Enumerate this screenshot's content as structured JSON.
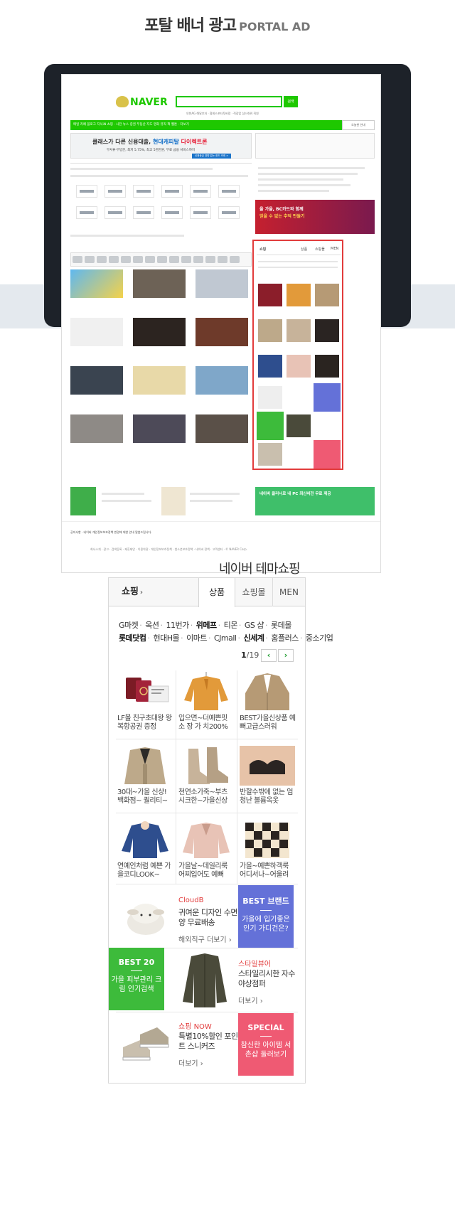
{
  "header": {
    "title": "포탈 배너 광고",
    "title_en": "PORTAL AD"
  },
  "naver": {
    "logo": "NAVER",
    "search_btn": "검색",
    "search_sub": "인천AG 해달부처 · 협회스포타투바람 · 직장탑 심터쉬워 직원",
    "menu": "메일 카페 블로그 지식iN 쇼핑 · 사전 뉴스 증권 부동산 지도 영화 뮤직 책 웹툰 · 더보기",
    "menu_right": "오늘한 안내",
    "banner_line1_a": "클래스가 다른 신용대출,",
    "banner_line1_b": "현대캐피탈",
    "banner_line1_c": "다이렉트론",
    "banner_line2": "무서류·무방문, 최저 5.75%, 최고 5천만원, 무료 금융 서비스까지",
    "banner_cta": "신용등급 영향 없는 한도 조회 >",
    "ad_line1": "올 가을, BC카드와 함께",
    "ad_line2": "믿을 수 없는 추억 만들기",
    "bottom_green": "네이버 클리너로 내 PC 최신버전 무료 제공",
    "footer1": "공지사항 · 네이버 개인정보보호정책 변경에 대한 안내 말씀드립니다.",
    "footer2": "회사소개 · 광고 · 검색등록 · 제휴제안 · 이용약관 · 개인정보보호정책 · 청소년보호정책 · 네이버 정책 · 고객센터 · © NAVER Corp."
  },
  "section_title": "네이버 테마쇼핑",
  "tabs": {
    "shop": "쇼핑",
    "items": [
      "상품",
      "쇼핑몰",
      "MEN"
    ]
  },
  "malls": {
    "row1": [
      "G마켓",
      "옥션",
      "11번가",
      "위메프",
      "티몬",
      "GS 샵",
      "롯데몰"
    ],
    "row2": [
      "롯데닷컴",
      "현대H몰",
      "이마트",
      "CJmall",
      "신세계",
      "홈플러스",
      "중소기업"
    ]
  },
  "pager": {
    "current": "1",
    "total": "/19"
  },
  "products": [
    {
      "caption": "LF몰 친구초대왕 왕복항공권 증정",
      "icon": "passport-icon",
      "color": "#8b1e2a"
    },
    {
      "caption": "입으면~더예쁜핏 소 장 가 치200%",
      "icon": "orange-sweater-icon",
      "color": "#e29a3a"
    },
    {
      "caption": "BEST가을신상품 예뻐고급스러워",
      "icon": "jacket-icon",
      "color": "#b69a75"
    },
    {
      "caption": "30대~가을 신상! 백화점~ 퀄리티~",
      "icon": "trench-coat-icon",
      "color": "#bda98a"
    },
    {
      "caption": "천연소가죽~부츠 시크한~가을신상",
      "icon": "ankle-boots-icon",
      "color": "#c7b39a"
    },
    {
      "caption": "반할수밖에 없는 엄청난 볼륨옥옷",
      "icon": "bra-top-icon",
      "color": "#2a2422"
    },
    {
      "caption": "연예인처럼 예쁜 가을코디LOOK~",
      "icon": "blue-knit-icon",
      "color": "#2e4e8e"
    },
    {
      "caption": "가을날~데일리룩 어찌입어도 예뻐",
      "icon": "pink-blouse-icon",
      "color": "#e8c3b6"
    },
    {
      "caption": "가을~예쁜하객룩 어디서나~어울려",
      "icon": "check-top-icon",
      "color": "#2a2420"
    }
  ],
  "promos": [
    {
      "tag": "CloudB",
      "text": "귀여운 디자인 수면양 무료배송",
      "more": "해외직구 더보기",
      "icon": "sheep-toy-icon",
      "block_title": "BEST 브랜드",
      "block_text": "가을에 입기좋은 인기 가디건은?",
      "block_color": "#6471d8"
    },
    {
      "tag": "스타일뷰어",
      "text": "스타일리시한 자수 야상점퍼",
      "more": "더보기",
      "icon": "field-jacket-icon",
      "block_title": "BEST 20",
      "block_text": "가을 피부관리 크림 인기검색",
      "block_color": "#3dbb3b"
    },
    {
      "tag": "쇼핑 NOW",
      "text": "특별10%할인 포인트 스니커즈",
      "more": "더보기",
      "icon": "sneakers-icon",
      "block_title": "SPECIAL",
      "block_text": "참신한 아이템 서촌샵 둘러보기",
      "block_color": "#ef5a73"
    }
  ],
  "colors": {
    "green": "#1ec800",
    "highlight": "#e23c3c"
  }
}
